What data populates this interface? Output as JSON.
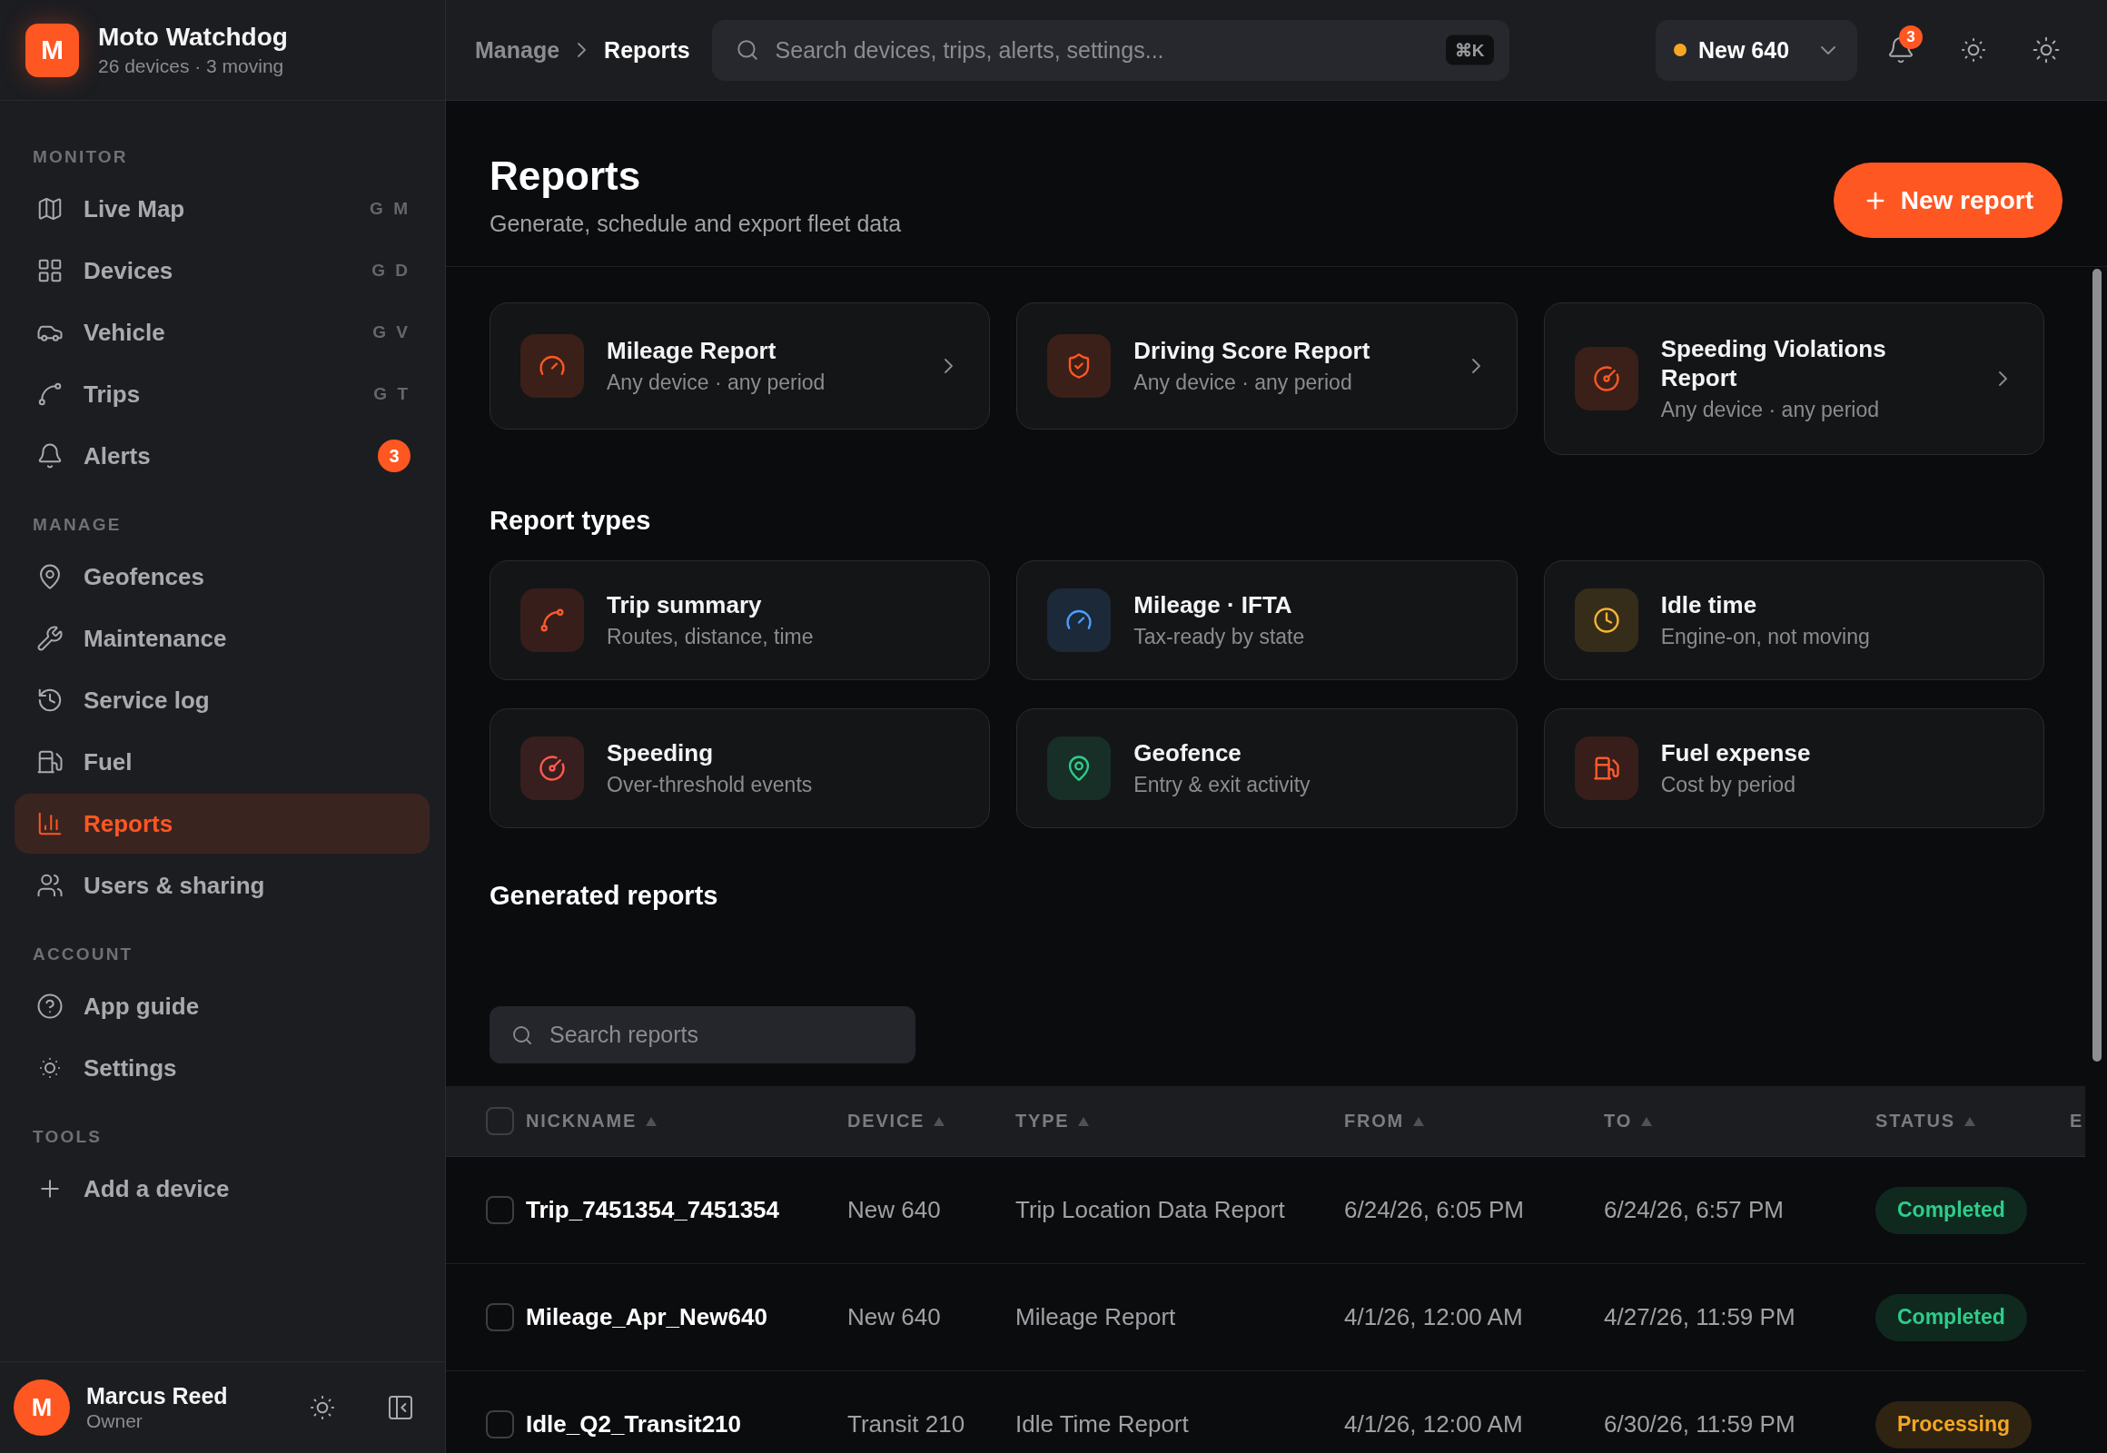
{
  "app": {
    "logo": "M",
    "name": "Moto Watchdog",
    "subtitle": "26 devices · 3 moving"
  },
  "sidebar": {
    "sections": [
      {
        "label": "MONITOR",
        "items": [
          {
            "label": "Live Map",
            "shortcut": "G M",
            "selected": false
          },
          {
            "label": "Devices",
            "shortcut": "G D",
            "selected": false
          },
          {
            "label": "Vehicle",
            "shortcut": "G V",
            "selected": false
          },
          {
            "label": "Trips",
            "shortcut": "G T",
            "selected": false
          },
          {
            "label": "Alerts",
            "badge": "3",
            "selected": false
          }
        ]
      },
      {
        "label": "MANAGE",
        "items": [
          {
            "label": "Geofences",
            "selected": false
          },
          {
            "label": "Maintenance",
            "selected": false
          },
          {
            "label": "Service log",
            "selected": false
          },
          {
            "label": "Fuel",
            "selected": false
          },
          {
            "label": "Reports",
            "selected": true
          },
          {
            "label": "Users & sharing",
            "selected": false
          }
        ]
      },
      {
        "label": "ACCOUNT",
        "items": [
          {
            "label": "App guide",
            "selected": false
          },
          {
            "label": "Settings",
            "selected": false
          }
        ]
      },
      {
        "label": "TOOLS",
        "items": [
          {
            "label": "Add a device",
            "selected": false
          }
        ]
      }
    ]
  },
  "user": {
    "avatar": "M",
    "name": "Marcus Reed",
    "role": "Owner"
  },
  "topbar": {
    "breadcrumb": [
      "Manage",
      "Reports"
    ],
    "search": {
      "placeholder": "Search devices, trips, alerts, settings...",
      "shortcut": "⌘K"
    },
    "device": {
      "label": "New 640",
      "color": "#f5a623"
    },
    "notifications": {
      "badge": "3"
    }
  },
  "page": {
    "title": "Reports",
    "subtitle": "Generate, schedule and export fleet data",
    "primary_action": "New report"
  },
  "quick_reports": [
    {
      "title": "Mileage Report",
      "subtitle": "Any device · any period"
    },
    {
      "title": "Driving Score Report",
      "subtitle": "Any device · any period"
    },
    {
      "title": "Speeding Violations Report",
      "subtitle": "Any device · any period"
    }
  ],
  "report_types": {
    "title": "Report types",
    "items": [
      {
        "title": "Trip summary",
        "subtitle": "Routes, distance, time",
        "color": "#ff5a2c"
      },
      {
        "title": "Mileage · IFTA",
        "subtitle": "Tax-ready by state",
        "color": "#4a9eff"
      },
      {
        "title": "Idle time",
        "subtitle": "Engine-on, not moving",
        "color": "#f5b431"
      },
      {
        "title": "Speeding",
        "subtitle": "Over-threshold events",
        "color": "#ff5a4f"
      },
      {
        "title": "Geofence",
        "subtitle": "Entry & exit activity",
        "color": "#2ecc8a"
      },
      {
        "title": "Fuel expense",
        "subtitle": "Cost by period",
        "color": "#ff5a2c"
      }
    ]
  },
  "generated_reports": {
    "title": "Generated reports",
    "search": {
      "placeholder": "Search reports"
    },
    "table": {
      "all_checked": false,
      "columns": [
        {
          "label": "NICKNAME"
        },
        {
          "label": "DEVICE"
        },
        {
          "label": "TYPE"
        },
        {
          "label": "FROM"
        },
        {
          "label": "TO"
        },
        {
          "label": "STATUS"
        }
      ],
      "column_7": {
        "label": "E"
      },
      "rows": [
        {
          "checked": false,
          "nickname": "Trip_7451354_7451354",
          "device": "New 640",
          "type": "Trip Location Data Report",
          "from": "6/24/26, 6:05 PM",
          "to": "6/24/26, 6:57 PM",
          "status": {
            "text": "Completed",
            "kind": "completed"
          }
        },
        {
          "checked": false,
          "nickname": "Mileage_Apr_New640",
          "device": "New 640",
          "type": "Mileage Report",
          "from": "4/1/26, 12:00 AM",
          "to": "4/27/26, 11:59 PM",
          "status": {
            "text": "Completed",
            "kind": "completed"
          }
        },
        {
          "checked": false,
          "nickname": "Idle_Q2_Transit210",
          "device": "Transit 210",
          "type": "Idle Time Report",
          "from": "4/1/26, 12:00 AM",
          "to": "6/30/26, 11:59 PM",
          "status": {
            "text": "Processing",
            "kind": "processing"
          }
        }
      ]
    }
  }
}
